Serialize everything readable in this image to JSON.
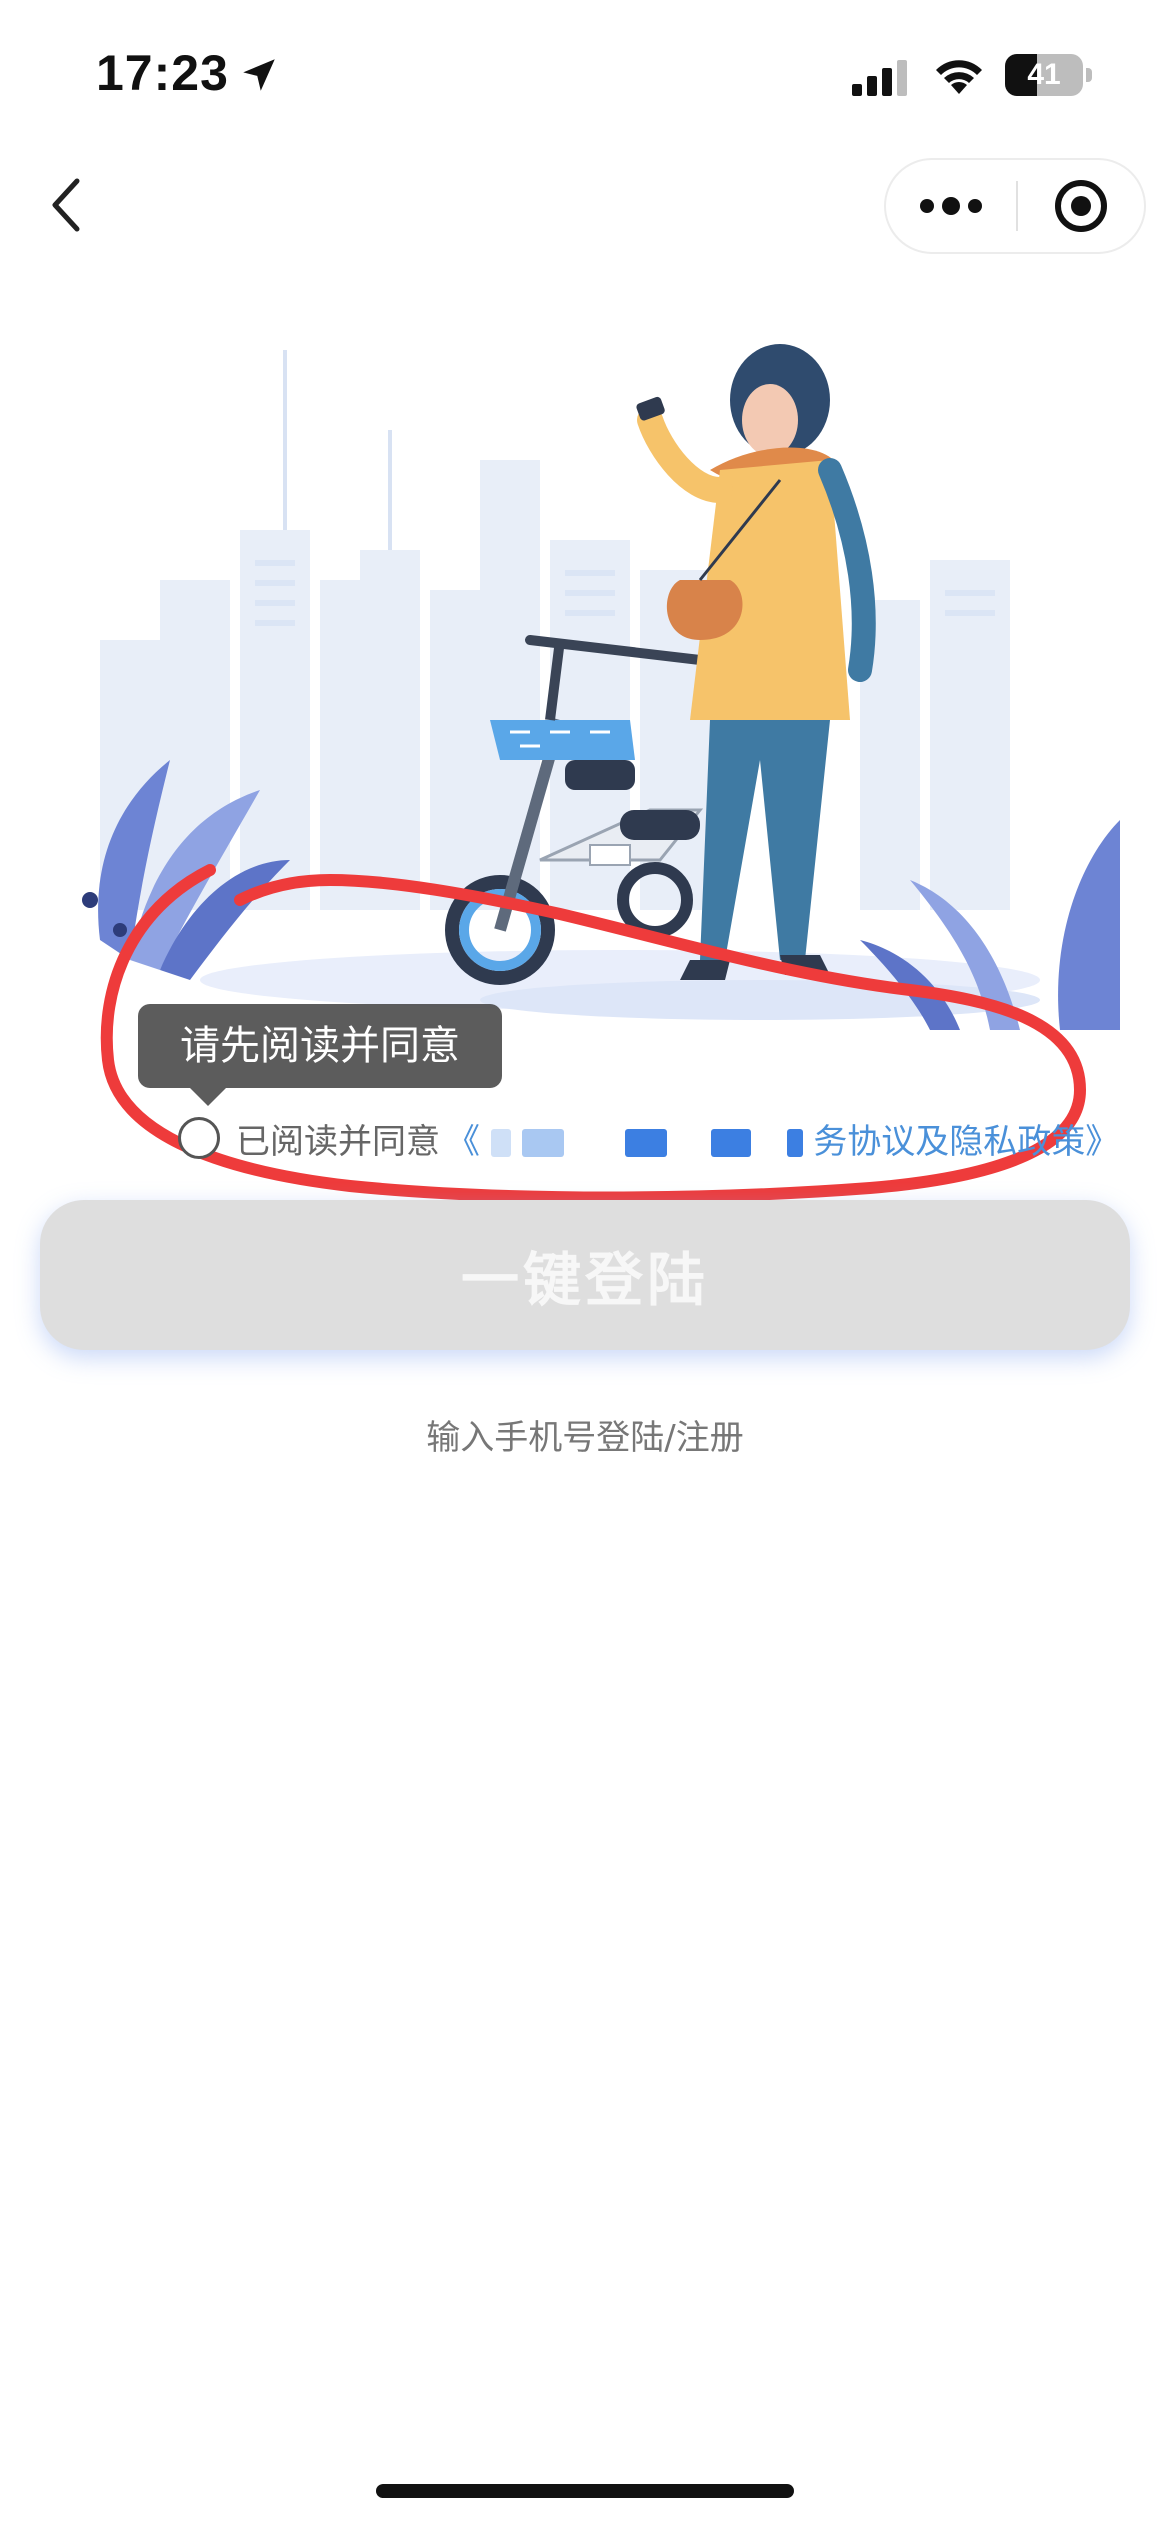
{
  "status_bar": {
    "time": "17:23",
    "battery_level": "41",
    "battery_fraction": 0.41
  },
  "icons": {
    "location": "location-arrow-icon",
    "signal": "cellular-signal-icon",
    "wifi": "wifi-icon",
    "back": "chevron-left-icon",
    "more": "more-dots-icon",
    "close": "target-close-icon"
  },
  "tooltip": {
    "text": "请先阅读并同意"
  },
  "agreement": {
    "label": "已阅读并同意",
    "link_prefix": "《",
    "link_suffix": "务协议及隐私政策》",
    "checked": false
  },
  "login": {
    "button_label": "一键登陆",
    "phone_link": "输入手机号登陆/注册"
  },
  "colors": {
    "link": "#4a90d9",
    "annotation": "#ee3b3b",
    "button_disabled": "#dedede",
    "scooter_blue": "#5aa7e8",
    "jacket": "#f6c36a",
    "jeans": "#3f7aa3"
  }
}
